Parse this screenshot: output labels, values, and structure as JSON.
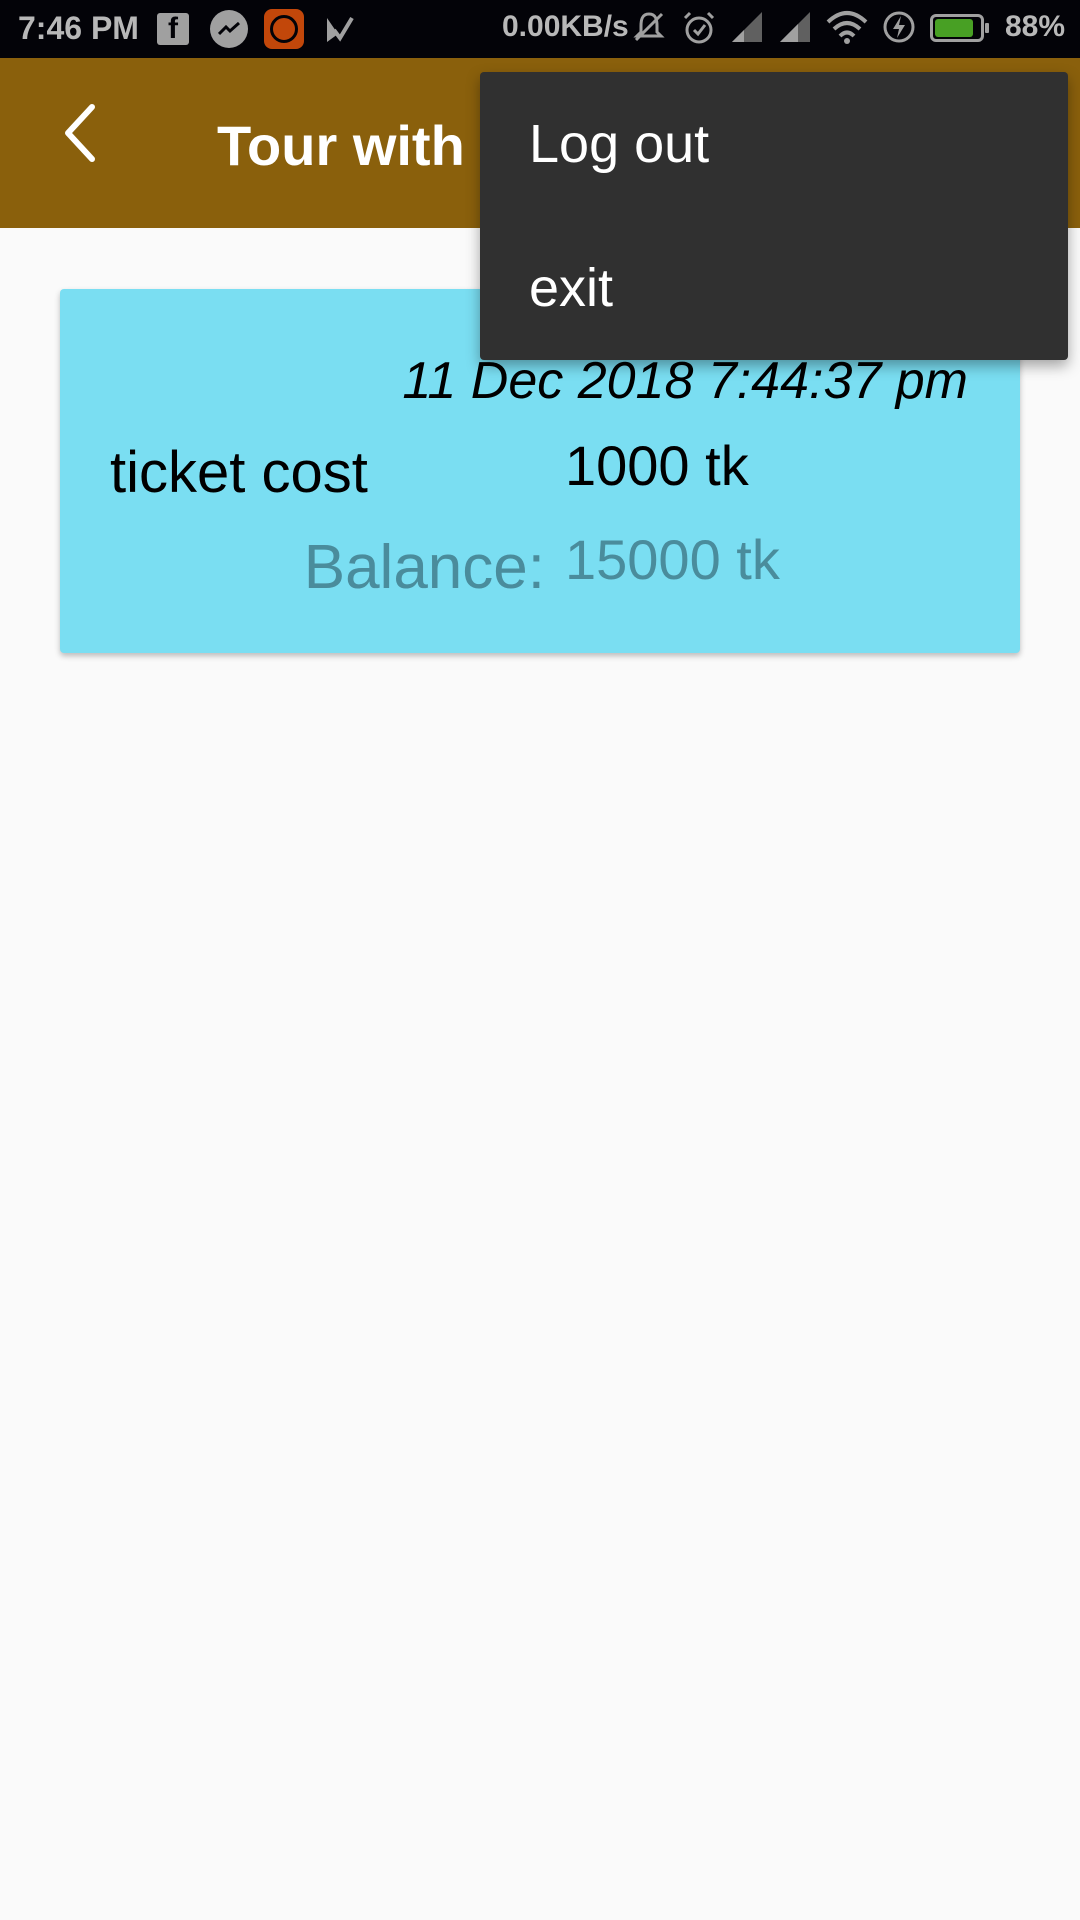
{
  "status_bar": {
    "time": "7:46 PM",
    "net_speed": "0.00KB/s",
    "battery_percent": "88%",
    "battery_level": 0.88,
    "left_icons": [
      "facebook-icon",
      "messenger-icon",
      "mi-app-icon",
      "checkmark-app-icon"
    ],
    "right_icons": [
      "mute-bell-icon",
      "alarm-icon",
      "signal-1-icon",
      "signal-2-icon",
      "wifi-icon",
      "charging-icon",
      "battery-icon"
    ]
  },
  "app_bar": {
    "title": "Tour with",
    "background": "#8a600c",
    "back_icon": "chevron-left-icon"
  },
  "card": {
    "background": "#7adef2",
    "date": "11 Dec 2018 7:44:37 pm",
    "ticket_label": "ticket cost",
    "ticket_value": "1000 tk",
    "balance_label": "Balance:",
    "balance_value": "15000 tk"
  },
  "menu": {
    "background": "#303030",
    "items": [
      {
        "label": "Log out"
      },
      {
        "label": "exit"
      }
    ]
  }
}
